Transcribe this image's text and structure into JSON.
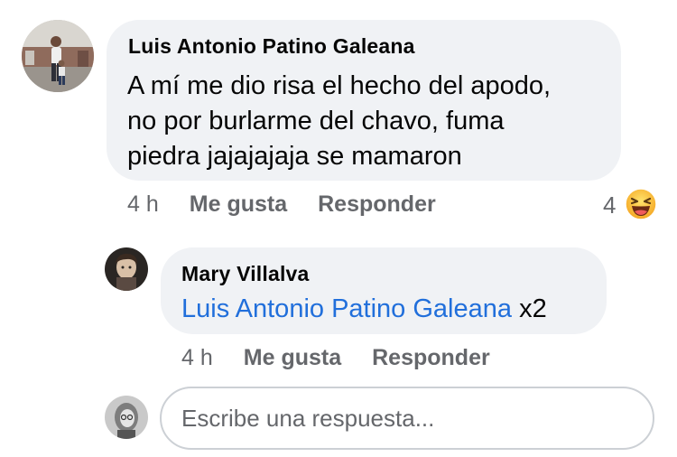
{
  "comment": {
    "author": "Luis Antonio Patino Galeana",
    "text_lines": [
      "A mí me dio risa el hecho del apodo,",
      "no por burlarme del chavo, fuma",
      "piedra jajajajaja se mamaron"
    ],
    "time": "4 h",
    "like_label": "Me gusta",
    "reply_label": "Responder",
    "reaction_count": "4",
    "reaction_icon": "laughing-emoji-icon"
  },
  "reply": {
    "author": "Mary Villalva",
    "mention": "Luis Antonio Patino Galeana",
    "suffix": "x2",
    "time": "4 h",
    "like_label": "Me gusta",
    "reply_label": "Responder"
  },
  "composer": {
    "placeholder": "Escribe una respuesta..."
  },
  "colors": {
    "bubble": "#f0f2f5",
    "mention": "#216fdb",
    "meta": "#65676b"
  }
}
